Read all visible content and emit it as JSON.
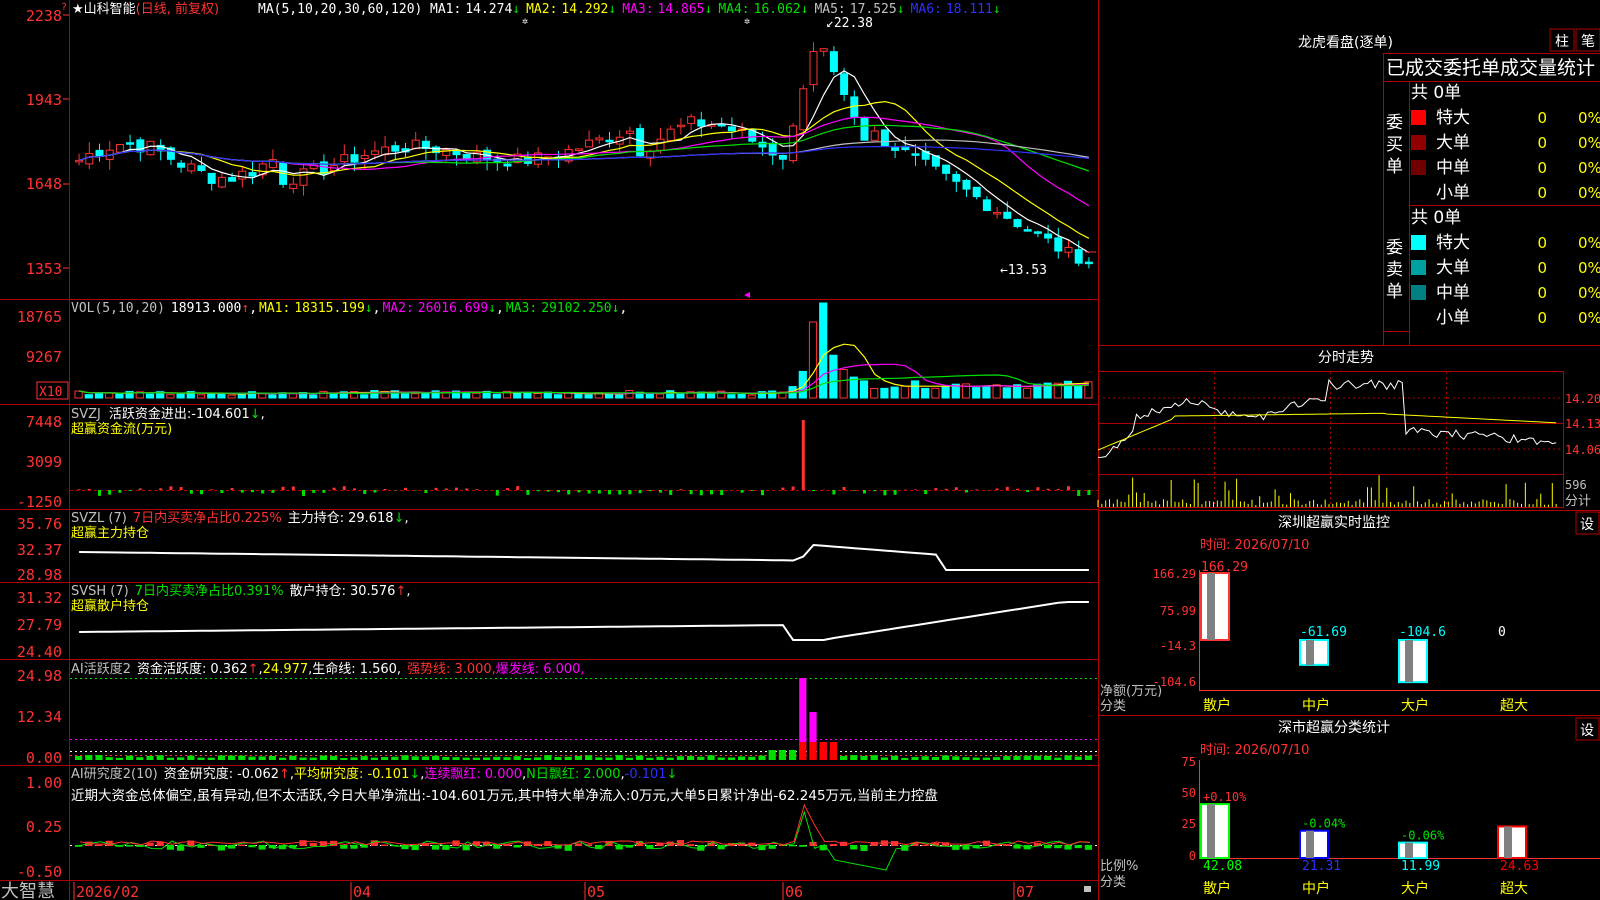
{
  "colors": {
    "red": "#ff3232",
    "cyan": "#00ffff",
    "yellow": "#ffff00",
    "magenta": "#ff00ff",
    "green": "#00e000",
    "white": "#ffffff",
    "blue": "#3030ff",
    "grid": "#b00000"
  },
  "main": {
    "star": "★",
    "stock": "山科智能",
    "mode": "(日线, 前复权)",
    "ma_label": "MA(5,10,20,30,60,120)",
    "ma_items": [
      {
        "label": "MA1:",
        "value": "14.274",
        "arrow": "↓",
        "color": "#ffffff"
      },
      {
        "label": "MA2:",
        "value": "14.292",
        "arrow": "↓",
        "color": "#ffff00"
      },
      {
        "label": "MA3:",
        "value": "14.865",
        "arrow": "↓",
        "color": "#ff00ff"
      },
      {
        "label": "MA4:",
        "value": "16.062",
        "arrow": "↓",
        "color": "#00e000"
      },
      {
        "label": "MA5:",
        "value": "17.525",
        "arrow": "↓",
        "color": "#c0c0c0"
      },
      {
        "label": "MA6:",
        "value": "18.111",
        "arrow": "↓",
        "color": "#3030ff"
      }
    ],
    "y_ticks": [
      "2238",
      "1943",
      "1648",
      "1353"
    ],
    "high_mark": "22.38",
    "low_mark": "←13.53"
  },
  "vol": {
    "label": "VOL(5,10,20)",
    "value": "18913.000",
    "arrow": "↑",
    "items": [
      {
        "label": "MA1:",
        "value": "18315.199",
        "arrow": "↓",
        "color": "#ffff00"
      },
      {
        "label": "MA2:",
        "value": "26016.699",
        "arrow": "↓",
        "color": "#ff00ff"
      },
      {
        "label": "MA3:",
        "value": "29102.250",
        "arrow": "↓",
        "color": "#00e000"
      }
    ],
    "y_ticks": [
      "18765",
      "9267"
    ],
    "unit": "X10"
  },
  "svzj": {
    "label": "SVZJ",
    "desc": "活跃资金进出:",
    "value": "-104.601",
    "arrow": "↓",
    "comma": ",",
    "sub": "超赢资金流(万元)",
    "y_ticks": [
      "7448",
      "3099",
      "-1250"
    ]
  },
  "svzl": {
    "label": "SVZL (7)",
    "desc": "7日内买卖净占比0.225%",
    "desc2": "主力持仓:",
    "value": "29.618",
    "arrow": "↓",
    "comma": ",",
    "sub": "超赢主力持仓",
    "y_ticks": [
      "35.76",
      "32.37",
      "28.98"
    ]
  },
  "svsh": {
    "label": "SVSH (7)",
    "desc": "7日内买卖净占比0.391%",
    "desc2": "散户持仓:",
    "value": "30.576",
    "arrow": "↑",
    "comma": ",",
    "sub": "超赢散户持仓",
    "y_ticks": [
      "31.32",
      "27.79",
      "24.40"
    ]
  },
  "ai1": {
    "label": "AI活跃度2",
    "desc": "资金活跃度:",
    "value": "0.362",
    "arrow": "↑",
    "v2": "24.977",
    "desc3": "生命线:",
    "v3": "1.560",
    "desc4": "强势线:",
    "v4": "3.000",
    "desc5": "爆发线:",
    "v5": "6.000",
    "y_ticks": [
      "24.98",
      "12.34",
      "0.00"
    ]
  },
  "ai2": {
    "label": "AI研究度2(10)",
    "desc": "资金研究度:",
    "value": "-0.062",
    "arrow": "↑",
    "desc2": "平均研究度:",
    "v2": "-0.101",
    "desc3": "连续飘红:",
    "v3": "0.000",
    "desc4": "N日飘红:",
    "v4": "2.000",
    "v5": "-0.101",
    "text": "近期大资金总体偏空,虽有异动,但不太活跃,今日大单净流出:-104.601万元,其中特大单净流入:0万元,大单5日累计净出-62.245万元,当前主力控盘",
    "y_ticks": [
      "1.00",
      "0.25",
      "-0.50"
    ]
  },
  "bottom": {
    "brand": "大智慧",
    "dates": [
      "2026/02",
      "04",
      "05",
      "06",
      "07"
    ]
  },
  "right": {
    "lhb": {
      "title": "龙虎看盘(逐单)",
      "btn1": "柱",
      "btn2": "笔",
      "header": "已成交委托单成交量统计",
      "buy": {
        "side": "委买单",
        "total": "共 0单",
        "rows": [
          {
            "name": "特大",
            "count": "0",
            "pct": "0%",
            "color": "#ff0000"
          },
          {
            "name": "大单",
            "count": "0",
            "pct": "0%",
            "color": "#900000"
          },
          {
            "name": "中单",
            "count": "0",
            "pct": "0%",
            "color": "#700000"
          },
          {
            "name": "小单",
            "count": "0",
            "pct": "0%",
            "color": "#000000"
          }
        ]
      },
      "sell": {
        "side": "委卖单",
        "total": "共 0单",
        "rows": [
          {
            "name": "特大",
            "count": "0",
            "pct": "0%",
            "color": "#00ffff"
          },
          {
            "name": "大单",
            "count": "0",
            "pct": "0%",
            "color": "#00a0a0"
          },
          {
            "name": "中单",
            "count": "0",
            "pct": "0%",
            "color": "#008080"
          },
          {
            "name": "小单",
            "count": "0",
            "pct": "0%",
            "color": "#000000"
          }
        ]
      }
    },
    "intraday": {
      "title": "分时走势",
      "y_ticks": [
        "14.20",
        "14.13",
        "14.06"
      ],
      "vol_tick": "596",
      "unit": "分计"
    },
    "monitor": {
      "title": "深圳超赢实时监控",
      "btn": "设",
      "time": "时间: 2026/07/10",
      "y_ticks": [
        "166.29",
        "75.99",
        "-14.3",
        "-104.6"
      ],
      "axis_label": "净额(万元)",
      "cat_label": "分类",
      "bars": [
        {
          "cat": "散户",
          "value": 166.29,
          "label": "166.29"
        },
        {
          "cat": "中户",
          "value": -61.69,
          "label": "-61.69"
        },
        {
          "cat": "大户",
          "value": -104.6,
          "label": "-104.6"
        },
        {
          "cat": "超大",
          "value": 0,
          "label": "0"
        }
      ]
    },
    "stats": {
      "title": "深市超赢分类统计",
      "btn": "设",
      "time": "时间: 2026/07/10",
      "y_ticks": [
        "75",
        "50",
        "25",
        "0"
      ],
      "axis_label": "比例%",
      "cat_label": "分类",
      "bars": [
        {
          "cat": "散户",
          "value": 42.08,
          "label": "42.08",
          "diff": "+0.10%",
          "color": "#00ff00"
        },
        {
          "cat": "中户",
          "value": 21.31,
          "label": "21.31",
          "diff": "-0.04%",
          "color": "#0000ff"
        },
        {
          "cat": "大户",
          "value": 11.99,
          "label": "11.99",
          "diff": "-0.06%",
          "color": "#00ffff"
        },
        {
          "cat": "超大",
          "value": 24.63,
          "label": "24.63",
          "diff": "",
          "color": "#ff0000"
        }
      ]
    }
  }
}
